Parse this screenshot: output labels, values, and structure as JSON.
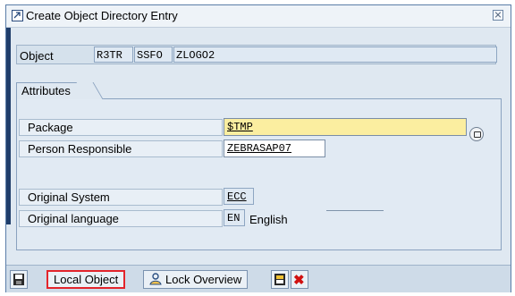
{
  "window": {
    "title": "Create Object Directory Entry"
  },
  "object": {
    "label": "Object",
    "pgmid": "R3TR",
    "type": "SSFO",
    "name": "ZLOGO2"
  },
  "attributes": {
    "group_label": "Attributes",
    "package_label": "Package",
    "package_value": "$TMP",
    "person_label": "Person Responsible",
    "person_value": "ZEBRASAP07",
    "system_label": "Original System",
    "system_value": "ECC",
    "language_label": "Original language",
    "language_code": "EN",
    "language_text": "English"
  },
  "toolbar": {
    "local_object": "Local Object",
    "lock_overview": "Lock Overview"
  },
  "icons": [
    "dialog-title-icon",
    "close-icon",
    "value-help-icon",
    "save-icon",
    "lock-icon",
    "display-icon",
    "cancel-icon"
  ],
  "colors": {
    "required_field": "#fbeea0",
    "highlight_border": "#e3242b",
    "dialog_bg": "#dfe8f1"
  }
}
